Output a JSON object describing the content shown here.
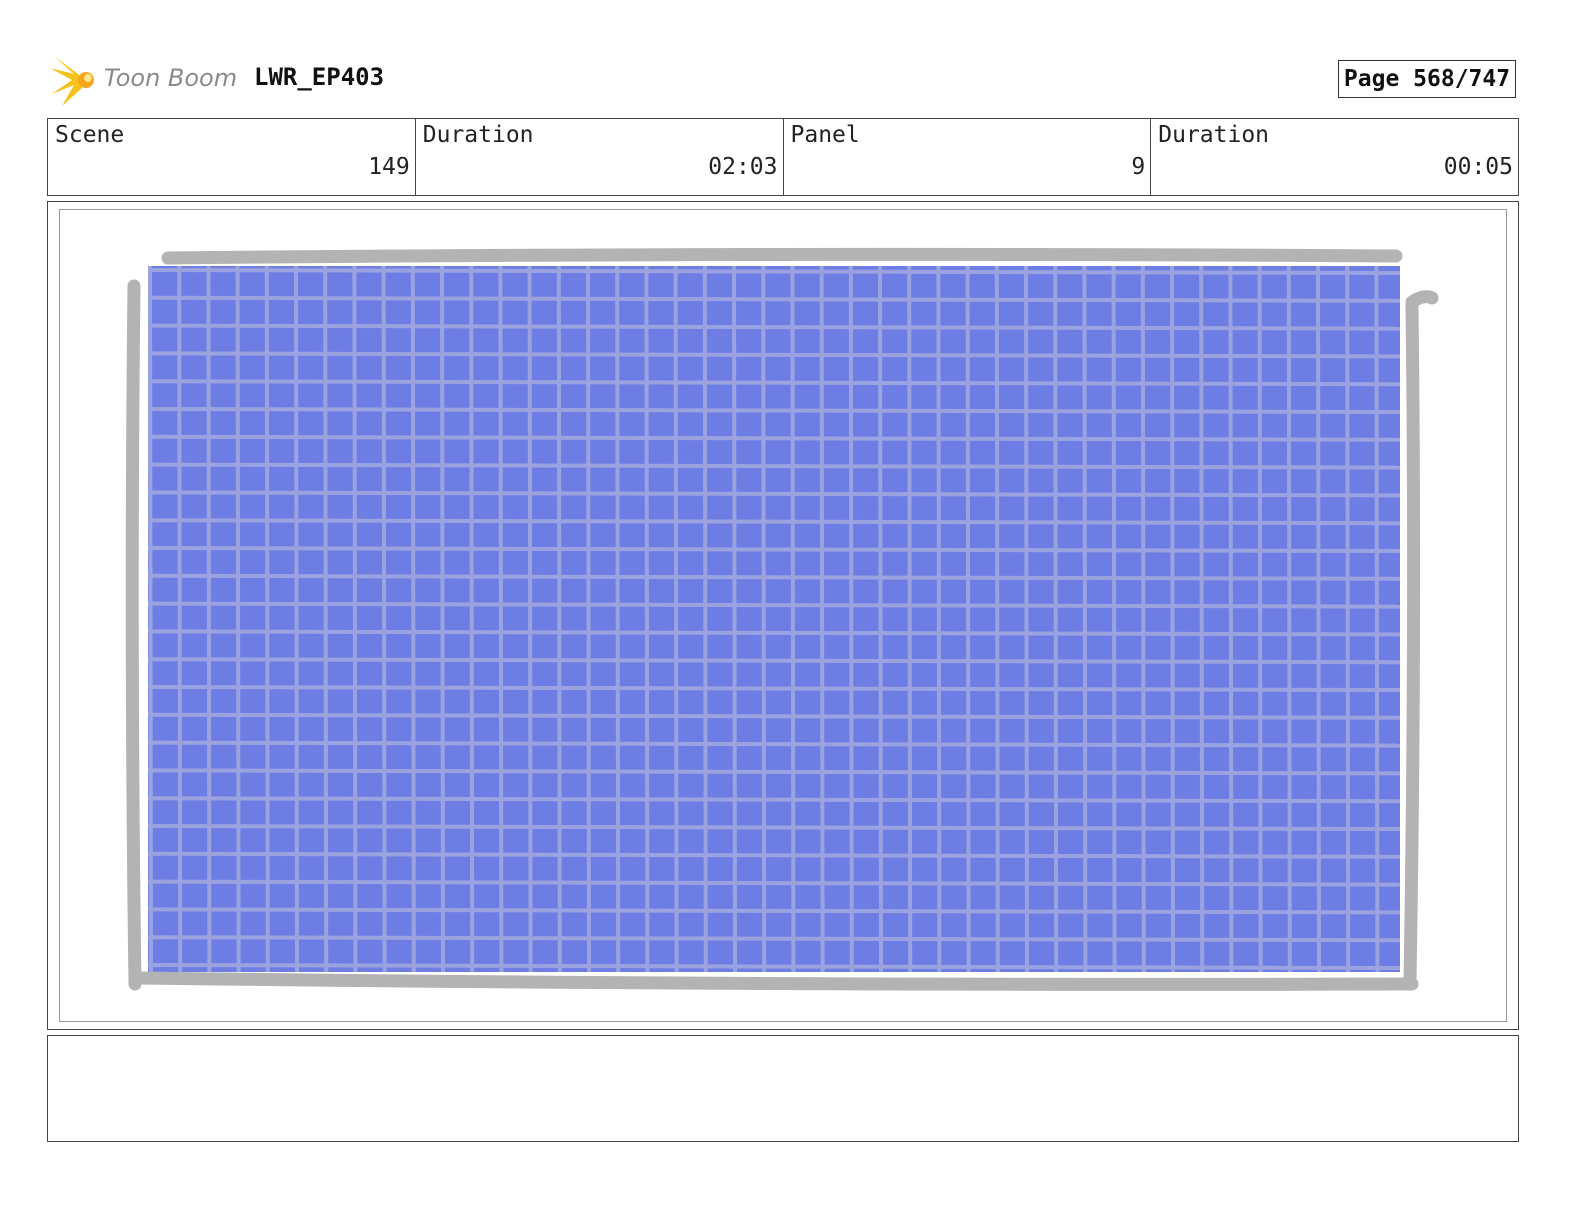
{
  "header": {
    "logo_text": "Toon Boom",
    "project_title": "LWR_EP403",
    "page_label": "Page",
    "page_value": "568/747"
  },
  "info": {
    "scene_label": "Scene",
    "scene_value": "149",
    "duration_label": "Duration",
    "duration_value": "02:03",
    "panel_label": "Panel",
    "panel_value": "9",
    "panel_duration_label": "Duration",
    "panel_duration_value": "00:05"
  },
  "panel_art": {
    "fill_color": "#6e7de4",
    "grid_line_color": "#9aa3e0",
    "frame_stroke_color": "#b3b3b3"
  },
  "notes": {
    "text": ""
  }
}
